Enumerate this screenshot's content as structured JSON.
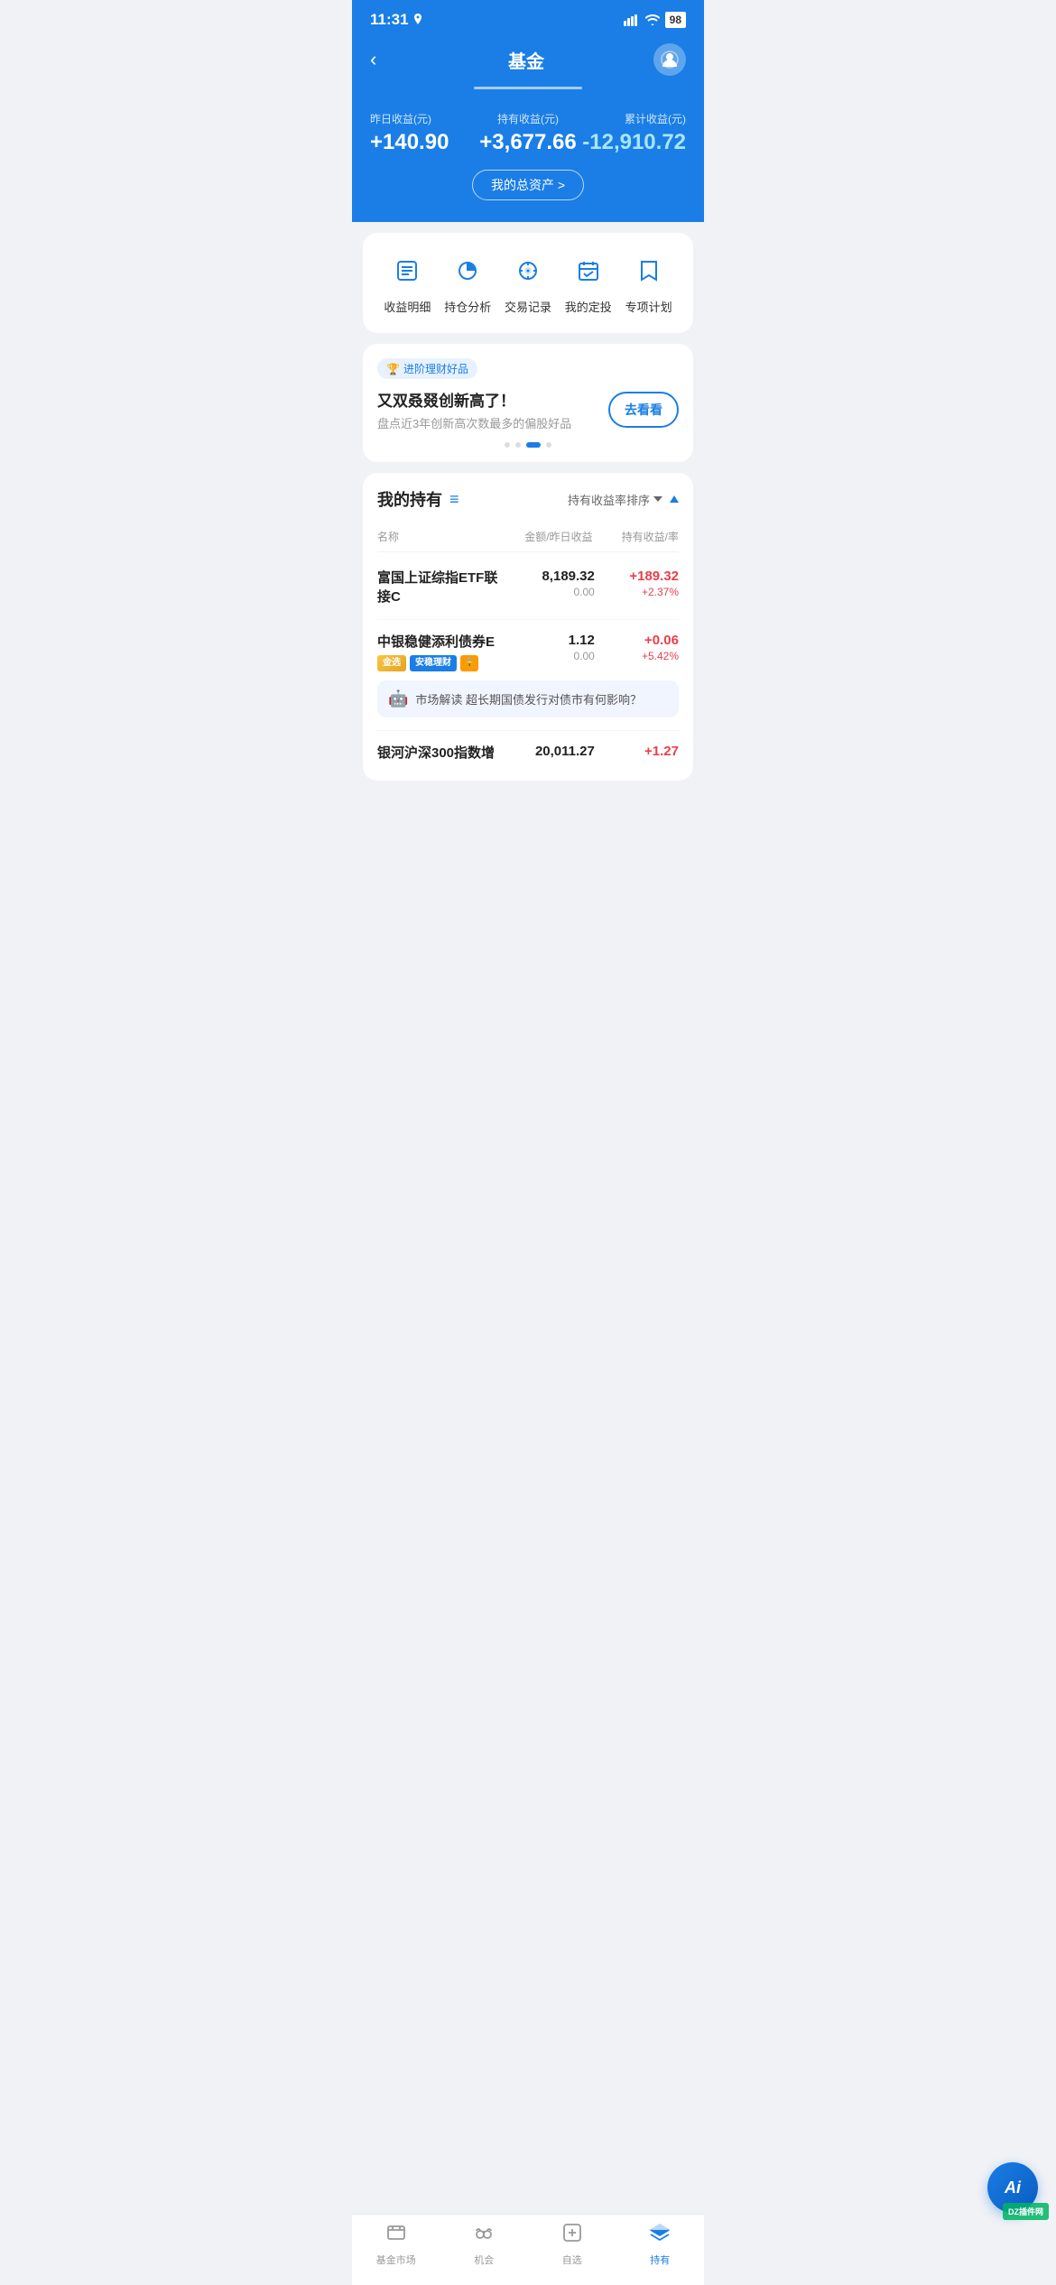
{
  "statusBar": {
    "time": "11:31",
    "battery": "98"
  },
  "header": {
    "title": "基金",
    "backLabel": "‹",
    "avatarIcon": "👤"
  },
  "stats": {
    "yesterday": {
      "label": "昨日收益(元)",
      "value": "+140.90"
    },
    "holding": {
      "label": "持有收益(元)",
      "value": "+3,677.66"
    },
    "cumulative": {
      "label": "累计收益(元)",
      "value": "-12,910.72"
    },
    "totalAssetsBtn": "我的总资产 >"
  },
  "menu": {
    "items": [
      {
        "id": "profit-detail",
        "label": "收益明细",
        "icon": "profit"
      },
      {
        "id": "position-analysis",
        "label": "持仓分析",
        "icon": "chart"
      },
      {
        "id": "trade-record",
        "label": "交易记录",
        "icon": "record"
      },
      {
        "id": "my-fixed",
        "label": "我的定投",
        "icon": "calendar"
      },
      {
        "id": "special-plan",
        "label": "专项计划",
        "icon": "plan"
      }
    ]
  },
  "promo": {
    "tag": "进阶理财好品",
    "tagIcon": "🏆",
    "title": "又双叒叕创新高了！",
    "subtitle": "盘点近3年创新高次数最多的偏股好品",
    "btnLabel": "去看看"
  },
  "holdings": {
    "sectionTitle": "我的持有",
    "sortLabel": "持有收益率排序",
    "colHeaders": {
      "name": "名称",
      "amount": "金额/昨日收益",
      "profit": "持有收益/率"
    },
    "funds": [
      {
        "id": "fund-1",
        "name": "富国上证综指ETF联接C",
        "amount": "8,189.32",
        "amountSub": "0.00",
        "profit": "+189.32",
        "profitRate": "+2.37%",
        "badges": [],
        "insight": null
      },
      {
        "id": "fund-2",
        "name": "中银稳健添利债券E",
        "amount": "1.12",
        "amountSub": "0.00",
        "profit": "+0.06",
        "profitRate": "+5.42%",
        "badges": [
          "金选",
          "安稳理财"
        ],
        "insight": "市场解读 超长期国债发行对债市有何影响？"
      },
      {
        "id": "fund-3",
        "name": "银河沪深300指数增",
        "amount": "20,011.27",
        "amountSub": "",
        "profit": "+1.27",
        "profitRate": "",
        "badges": [],
        "insight": null,
        "partial": true
      }
    ]
  },
  "bottomNav": {
    "items": [
      {
        "id": "fund-market",
        "label": "基金市场",
        "icon": "market",
        "active": false
      },
      {
        "id": "opportunity",
        "label": "机会",
        "icon": "binoculars",
        "active": false
      },
      {
        "id": "watchlist",
        "label": "自选",
        "icon": "add",
        "active": false
      },
      {
        "id": "holdings",
        "label": "持有",
        "icon": "layers",
        "active": true
      }
    ]
  },
  "ai": {
    "label": "Ai"
  },
  "watermark": "DZ插件网"
}
